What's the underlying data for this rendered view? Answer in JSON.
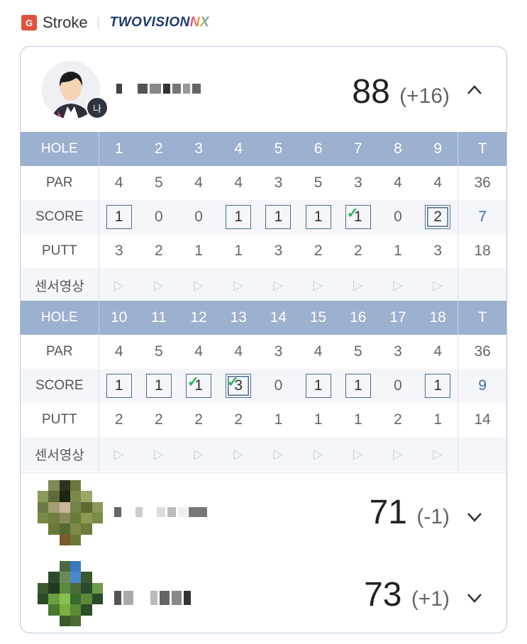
{
  "header": {
    "badge": "G",
    "mode": "Stroke",
    "brand_main": "TWOVISION",
    "brand_accent": "NX"
  },
  "me_badge": "나",
  "player1": {
    "score": "88",
    "relative": "(+16)",
    "chevron": "^",
    "front": {
      "hole_label": "HOLE",
      "holes": [
        "1",
        "2",
        "3",
        "4",
        "5",
        "6",
        "7",
        "8",
        "9"
      ],
      "total_label": "T",
      "par_label": "PAR",
      "par": [
        "4",
        "5",
        "4",
        "4",
        "3",
        "5",
        "3",
        "4",
        "4"
      ],
      "par_total": "36",
      "score_label": "SCORE",
      "scores": [
        "1",
        "0",
        "0",
        "1",
        "1",
        "1",
        "1",
        "0",
        "2"
      ],
      "score_total": "7",
      "putt_label": "PUTT",
      "putts": [
        "3",
        "2",
        "1",
        "1",
        "3",
        "2",
        "2",
        "1",
        "3"
      ],
      "putt_total": "18",
      "sensor_label": "센서영상"
    },
    "back": {
      "hole_label": "HOLE",
      "holes": [
        "10",
        "11",
        "12",
        "13",
        "14",
        "15",
        "16",
        "17",
        "18"
      ],
      "total_label": "T",
      "par_label": "PAR",
      "par": [
        "4",
        "5",
        "4",
        "4",
        "3",
        "4",
        "5",
        "3",
        "4"
      ],
      "par_total": "36",
      "score_label": "SCORE",
      "scores": [
        "1",
        "1",
        "1",
        "3",
        "0",
        "1",
        "1",
        "0",
        "1"
      ],
      "score_total": "9",
      "putt_label": "PUTT",
      "putts": [
        "2",
        "2",
        "2",
        "2",
        "1",
        "1",
        "1",
        "2",
        "1"
      ],
      "putt_total": "14",
      "sensor_label": "센서영상"
    }
  },
  "player2": {
    "score": "71",
    "relative": "(-1)",
    "chevron": "∨"
  },
  "player3": {
    "score": "73",
    "relative": "(+1)",
    "chevron": "∨"
  },
  "colors": {
    "header_row": "#9cb0d0",
    "score_box": "#4a6a90",
    "check": "#2bb24c",
    "total_blue": "#3b6fb0"
  }
}
